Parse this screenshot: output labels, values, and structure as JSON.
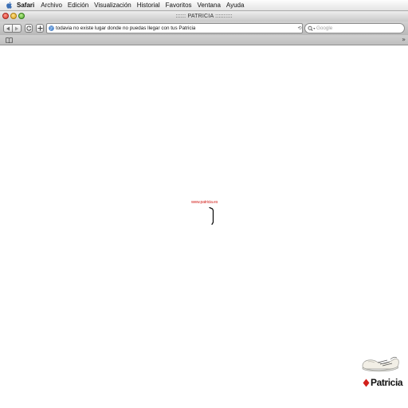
{
  "menubar": {
    "apple_icon": "apple-logo-icon",
    "app_name": "Safari",
    "items": [
      "Archivo",
      "Edición",
      "Visualización",
      "Historial",
      "Favoritos",
      "Ventana",
      "Ayuda"
    ]
  },
  "window": {
    "title": ":::::: PATRICIA ::::::::::"
  },
  "toolbar": {
    "back_icon": "back-arrow-icon",
    "forward_icon": "forward-arrow-icon",
    "reload_icon": "reload-icon",
    "add_bookmark_icon": "plus-icon",
    "address": {
      "icon": "globe-icon",
      "value": "todavia no existe lugar donde no puedas llegar con tus Patricia"
    },
    "search": {
      "icon": "search-icon",
      "placeholder": "Google"
    }
  },
  "bookmarks_bar": {
    "book_icon": "bookmarks-book-icon",
    "overflow": "»"
  },
  "page": {
    "site_link": "www.patricia.es",
    "brand": {
      "name": "Patricia",
      "accent": "#d2201b"
    }
  },
  "colors": {
    "link_red": "#d2201b",
    "close_light": "#d8332a",
    "minimize_light": "#d9a11c",
    "zoom_light": "#4ca52b"
  }
}
